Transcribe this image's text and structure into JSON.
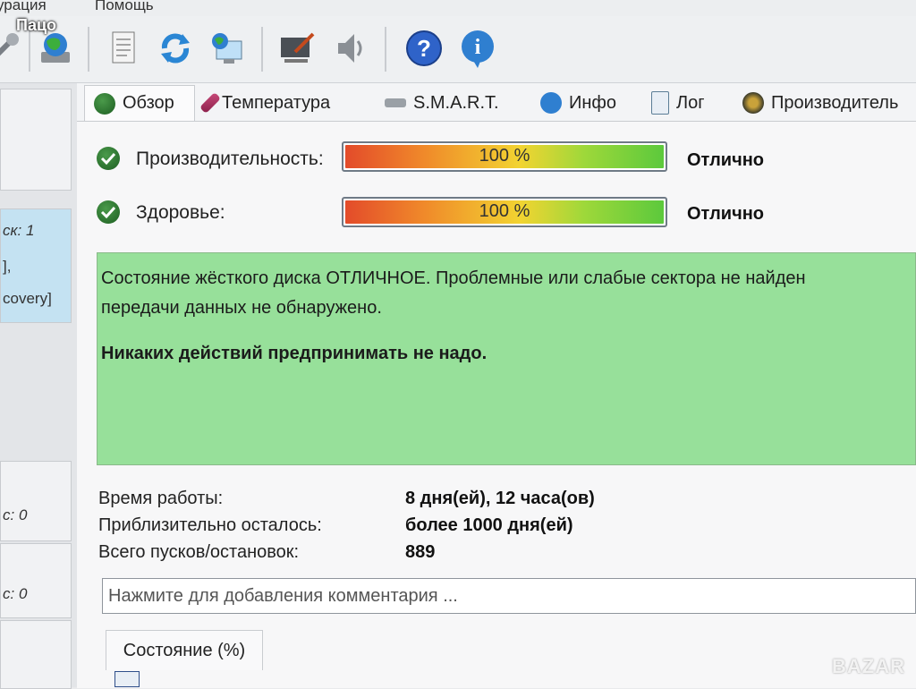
{
  "menu": {
    "items": [
      "урация",
      "Помощь"
    ]
  },
  "watermark": "Пацо",
  "brand": "BAZAR",
  "toolbar": {
    "icons": [
      "tools-icon",
      "globe-disk-icon",
      "document-icon",
      "refresh-icon",
      "network-computer-icon",
      "screen-brush-icon",
      "speaker-icon",
      "help-icon",
      "info-icon"
    ]
  },
  "sidebar": {
    "lines": [
      "ск: 1",
      "],",
      "covery]",
      "с: 0",
      "с: 0"
    ]
  },
  "tabs": [
    {
      "label": "Обзор",
      "icon": "check-circle-icon"
    },
    {
      "label": "Температура",
      "icon": "thermometer-icon"
    },
    {
      "label": "S.M.A.R.T.",
      "icon": "smart-icon"
    },
    {
      "label": "Инфо",
      "icon": "info-icon"
    },
    {
      "label": "Лог",
      "icon": "log-icon"
    },
    {
      "label": "Производитель",
      "icon": "gauge-icon"
    }
  ],
  "performance": {
    "label": "Производительность:",
    "value": 100,
    "text": "100 %",
    "verdict": "Отлично"
  },
  "health": {
    "label": "Здоровье:",
    "value": 100,
    "text": "100 %",
    "verdict": "Отлично"
  },
  "status": {
    "line1": "Состояние жёсткого диска ОТЛИЧНОЕ. Проблемные или слабые сектора не найден",
    "line2": "передачи данных не обнаружено.",
    "advice": "Никаких действий предпринимать не надо."
  },
  "stats": {
    "uptime_label": "Время работы:",
    "uptime_value": "8 дня(ей), 12 часа(ов)",
    "remaining_label": "Приблизительно осталось:",
    "remaining_value": "более 1000 дня(ей)",
    "starts_label": "Всего пусков/остановок:",
    "starts_value": "889"
  },
  "comment": {
    "placeholder": "Нажмите для добавления комментария ..."
  },
  "subtab": {
    "label": "Состояние (%)"
  },
  "colors": {
    "status_bg": "#97e09a",
    "check": "#2f7a33"
  }
}
